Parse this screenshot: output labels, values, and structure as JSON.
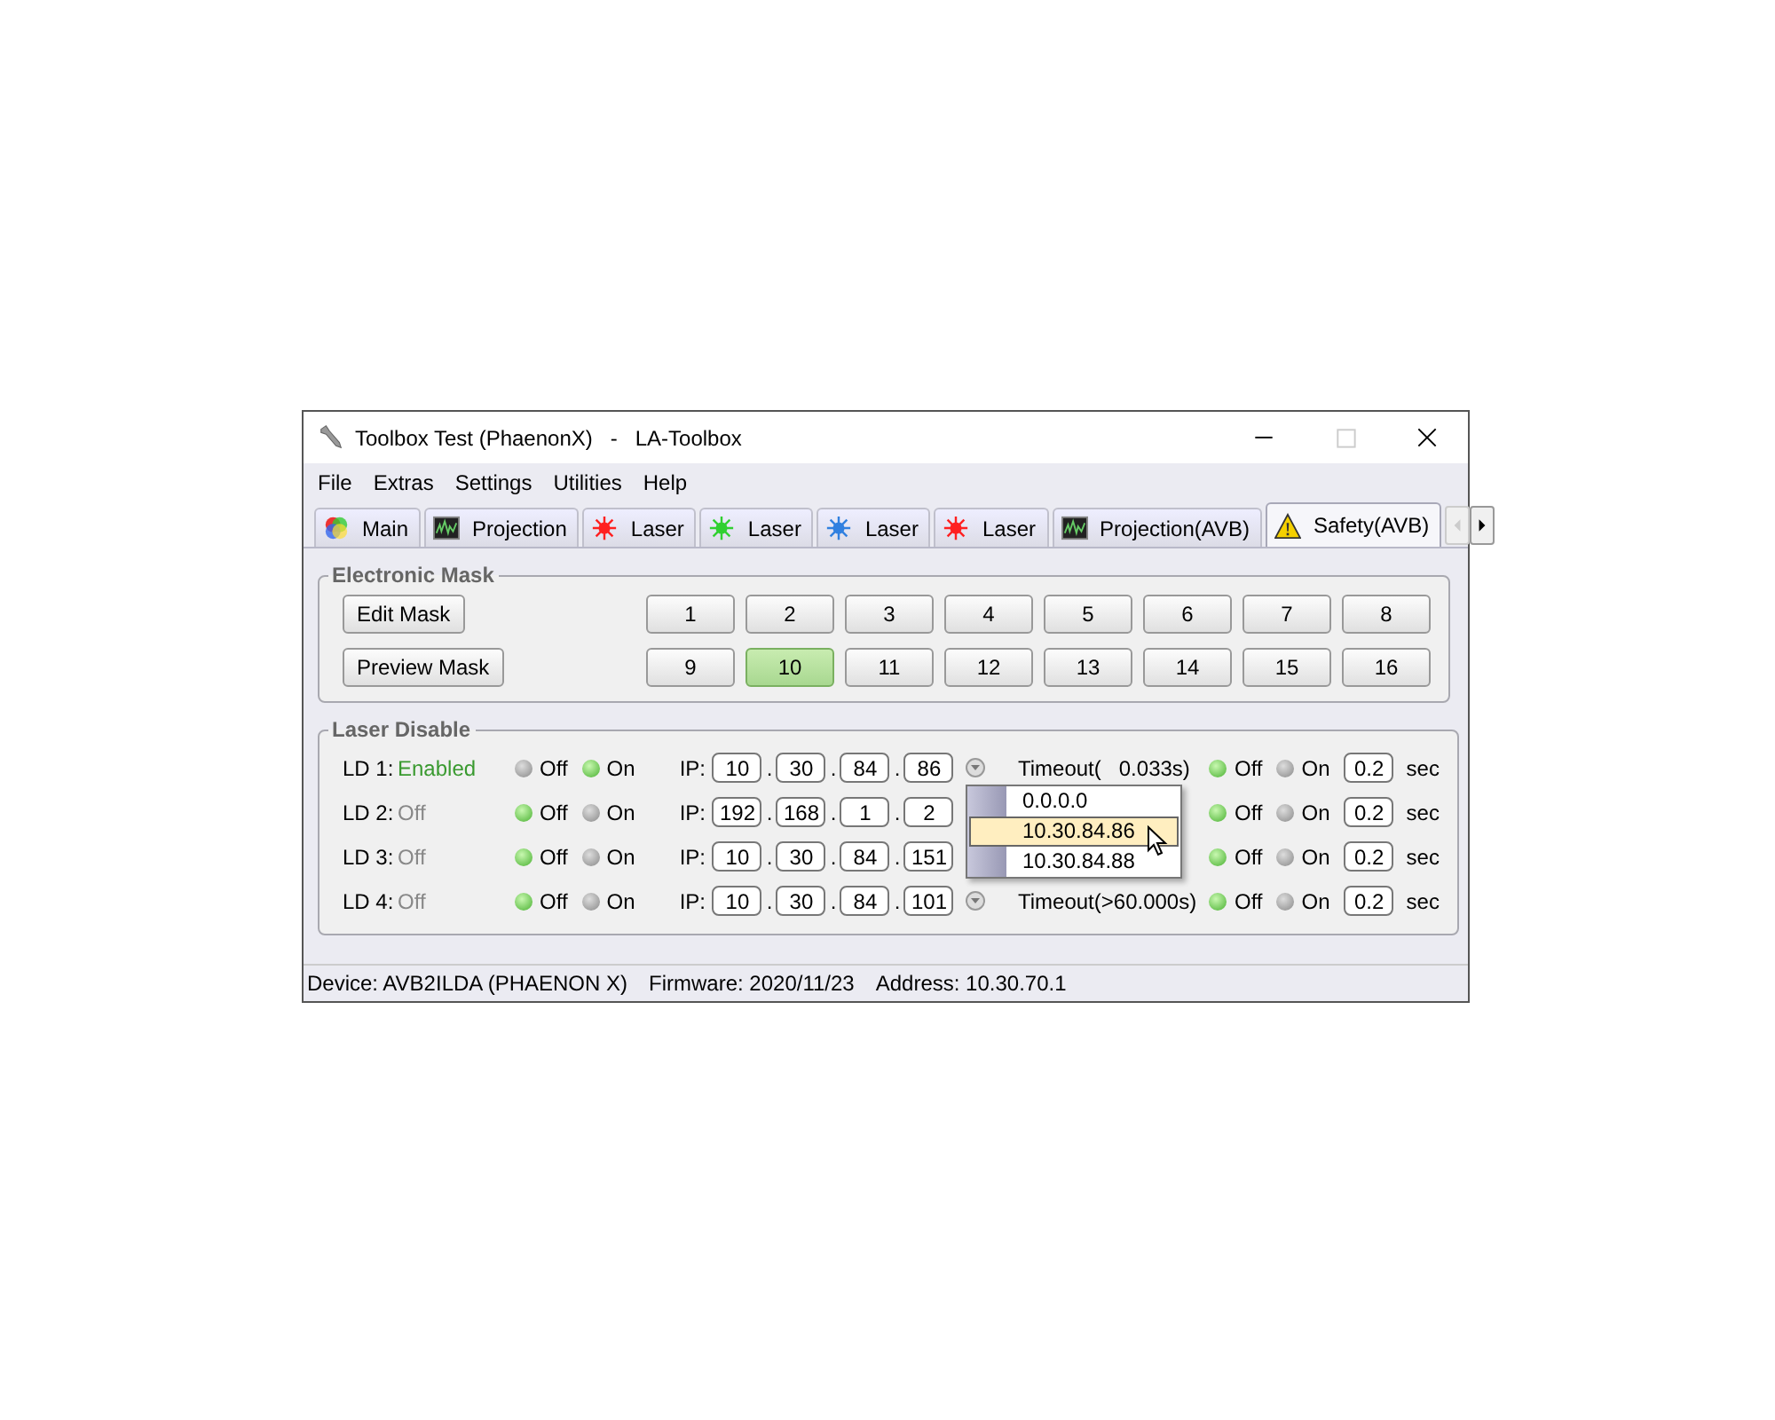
{
  "window": {
    "title": "Toolbox Test (PhaenonX)   -   LA-Toolbox",
    "maximize_disabled": true
  },
  "menu": [
    "File",
    "Extras",
    "Settings",
    "Utilities",
    "Help"
  ],
  "tabs": [
    {
      "label": "Main",
      "kind": "palette",
      "selected": false
    },
    {
      "label": "Projection",
      "kind": "waveform",
      "selected": false
    },
    {
      "label": "Laser",
      "kind": "laser",
      "color": "#ff2020",
      "selected": false
    },
    {
      "label": "Laser",
      "kind": "laser",
      "color": "#30d030",
      "selected": false
    },
    {
      "label": "Laser",
      "kind": "laser",
      "color": "#3080e0",
      "selected": false
    },
    {
      "label": "Laser",
      "kind": "laser",
      "color": "#ff2020",
      "selected": false
    },
    {
      "label": "Projection(AVB)",
      "kind": "waveform",
      "selected": false
    },
    {
      "label": "Safety(AVB)",
      "kind": "warning",
      "selected": true
    }
  ],
  "electronic_mask": {
    "title": "Electronic Mask",
    "edit_button": "Edit Mask",
    "preview_button": "Preview Mask",
    "masks": [
      {
        "label": "1",
        "selected": false
      },
      {
        "label": "2",
        "selected": false
      },
      {
        "label": "3",
        "selected": false
      },
      {
        "label": "4",
        "selected": false
      },
      {
        "label": "5",
        "selected": false
      },
      {
        "label": "6",
        "selected": false
      },
      {
        "label": "7",
        "selected": false
      },
      {
        "label": "8",
        "selected": false
      },
      {
        "label": "9",
        "selected": false
      },
      {
        "label": "10",
        "selected": true
      },
      {
        "label": "11",
        "selected": false
      },
      {
        "label": "12",
        "selected": false
      },
      {
        "label": "13",
        "selected": false
      },
      {
        "label": "14",
        "selected": false
      },
      {
        "label": "15",
        "selected": false
      },
      {
        "label": "16",
        "selected": false
      }
    ]
  },
  "laser_disable": {
    "title": "Laser Disable",
    "rows": [
      {
        "label": "LD 1:",
        "status": "Enabled",
        "enabled": true,
        "off": "Off",
        "on": "On",
        "ip_label": "IP:",
        "ip": [
          {
            "value": "10"
          },
          {
            "sep": ".",
            "value": "30"
          },
          {
            "sep": ".",
            "value": "84"
          },
          {
            "sep": ".",
            "value": "86"
          }
        ],
        "timeout": "Timeout(   0.033s)",
        "t_off": "Off",
        "t_on": "On",
        "timeout_on": false,
        "delay": "0.2",
        "unit": "sec"
      },
      {
        "label": "LD 2:",
        "status": "Off",
        "enabled": false,
        "off": "Off",
        "on": "On",
        "ip_label": "IP:",
        "ip": [
          {
            "value": "192"
          },
          {
            "sep": ".",
            "value": "168"
          },
          {
            "sep": ".",
            "value": "1"
          },
          {
            "sep": ".",
            "value": "2"
          }
        ],
        "t_off": "Off",
        "t_on": "On",
        "timeout_on": false,
        "delay": "0.2",
        "unit": "sec"
      },
      {
        "label": "LD 3:",
        "status": "Off",
        "enabled": false,
        "off": "Off",
        "on": "On",
        "ip_label": "IP:",
        "ip": [
          {
            "value": "10"
          },
          {
            "sep": ".",
            "value": "30"
          },
          {
            "sep": ".",
            "value": "84"
          },
          {
            "sep": ".",
            "value": "151"
          }
        ],
        "t_off": "Off",
        "t_on": "On",
        "timeout_on": false,
        "delay": "0.2",
        "unit": "sec"
      },
      {
        "label": "LD 4:",
        "status": "Off",
        "enabled": false,
        "off": "Off",
        "on": "On",
        "ip_label": "IP:",
        "ip": [
          {
            "value": "10"
          },
          {
            "sep": ".",
            "value": "30"
          },
          {
            "sep": ".",
            "value": "84"
          },
          {
            "sep": ".",
            "value": "101"
          }
        ],
        "timeout": "Timeout(>60.000s)",
        "t_off": "Off",
        "t_on": "On",
        "timeout_on": false,
        "delay": "0.2",
        "unit": "sec"
      }
    ],
    "ip_menu": [
      {
        "label": "0.0.0.0",
        "selected": false
      },
      {
        "label": "10.30.84.86",
        "selected": true
      },
      {
        "label": "10.30.84.88",
        "selected": false
      }
    ]
  },
  "status_bar": [
    "Device: AVB2ILDA (PHAENON X)",
    "Firmware: 2020/11/23",
    "Address: 10.30.70.1"
  ]
}
